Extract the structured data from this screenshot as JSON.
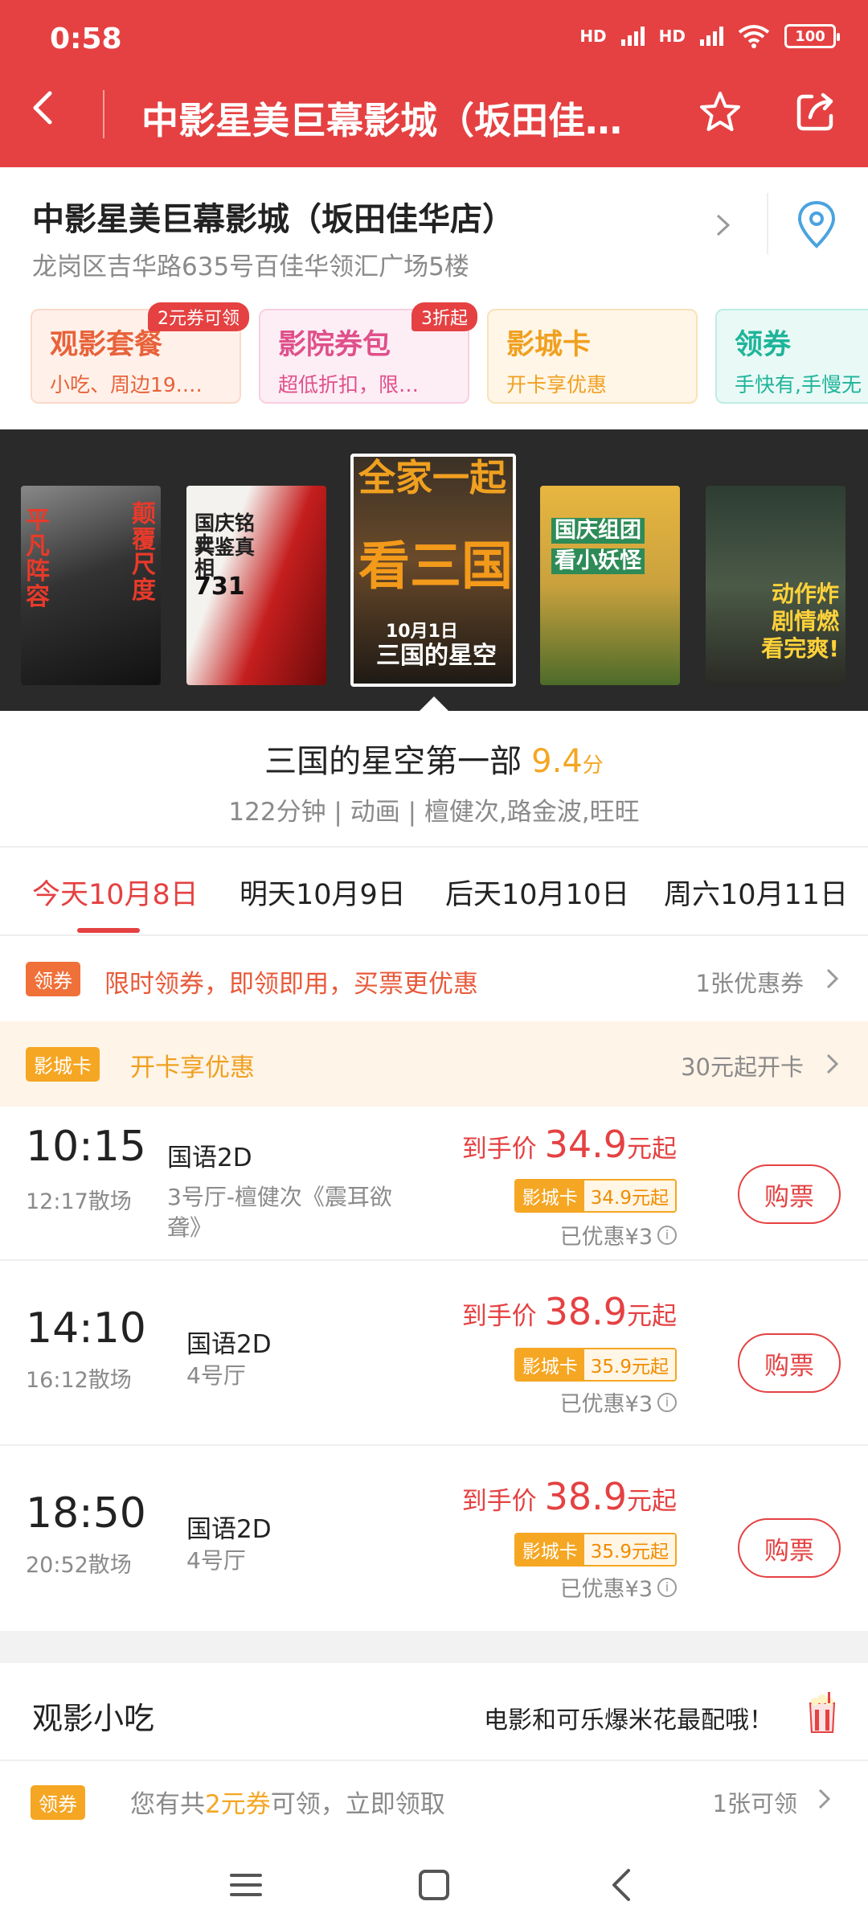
{
  "status_bar": {
    "time": "0:58",
    "network_1": "HD",
    "network_2": "HD",
    "battery": "100"
  },
  "header": {
    "title": "中影星美巨幕影城（坂田佳…"
  },
  "cinema": {
    "name": "中影星美巨幕影城（坂田佳华店）",
    "address": "龙岗区吉华路635号百佳华领汇广场5楼"
  },
  "promos": [
    {
      "title": "观影套餐",
      "subtitle": "小吃、周边19.…",
      "badge": "2元券可领"
    },
    {
      "title": "影院券包",
      "subtitle": "超低折扣，限…",
      "badge": "3折起"
    },
    {
      "title": "影城卡",
      "subtitle": "开卡享优惠",
      "badge": ""
    },
    {
      "title": "领券",
      "subtitle": "手快有,手慢无",
      "badge": ""
    }
  ],
  "posters": [
    {
      "text_1": "平凡阵容",
      "text_2": "颠覆尺度"
    },
    {
      "text_1": "国庆铭史",
      "text_2": "共鉴真相",
      "text_3": "731"
    },
    {
      "text_1": "全家一起",
      "text_2": "看三国",
      "text_3": "三国的星空",
      "text_4": "10月1日"
    },
    {
      "text_1": "国庆组团",
      "text_2": "看小妖怪"
    },
    {
      "text_1": "动作炸",
      "text_2": "剧情燃",
      "text_3": "看完爽!"
    }
  ],
  "movie": {
    "title": "三国的星空第一部",
    "score": "9.4",
    "score_unit": "分",
    "meta": "122分钟 | 动画 | 檀健次,路金波,旺旺"
  },
  "dates": [
    {
      "label": "今天10月8日",
      "active": true
    },
    {
      "label": "明天10月9日",
      "active": false
    },
    {
      "label": "后天10月10日",
      "active": false
    },
    {
      "label": "周六10月11日",
      "active": false
    }
  ],
  "coupon_bar": {
    "tag": "领券",
    "text": "限时领券，即领即用，买票更优惠",
    "right": "1张优惠券"
  },
  "card_bar": {
    "tag": "影城卡",
    "text": "开卡享优惠",
    "right": "30元起开卡"
  },
  "sessions": [
    {
      "start": "10:15",
      "end": "12:17散场",
      "lang": "国语2D",
      "hall": "3号厅-檀健次《震耳欲聋》",
      "price_prefix": "到手价",
      "price": "34.9",
      "price_suffix": "元起",
      "card_label": "影城卡",
      "card_price": "34.9元起",
      "discount": "已优惠¥3",
      "buy": "购票"
    },
    {
      "start": "14:10",
      "end": "16:12散场",
      "lang": "国语2D",
      "hall": "4号厅",
      "price_prefix": "到手价",
      "price": "38.9",
      "price_suffix": "元起",
      "card_label": "影城卡",
      "card_price": "35.9元起",
      "discount": "已优惠¥3",
      "buy": "购票"
    },
    {
      "start": "18:50",
      "end": "20:52散场",
      "lang": "国语2D",
      "hall": "4号厅",
      "price_prefix": "到手价",
      "price": "38.9",
      "price_suffix": "元起",
      "card_label": "影城卡",
      "card_price": "35.9元起",
      "discount": "已优惠¥3",
      "buy": "购票"
    }
  ],
  "snacks": {
    "title": "观影小吃",
    "slogan": "电影和可乐爆米花最配哦！"
  },
  "snack_coupon": {
    "tag": "领券",
    "text_before": "您有共",
    "highlight": "2元券",
    "text_after": "可领，立即领取",
    "right": "1张可领"
  },
  "colors": {
    "brand_red": "#e54142",
    "accent_orange": "#f5a623",
    "muted_gray": "#8a8a8a"
  }
}
